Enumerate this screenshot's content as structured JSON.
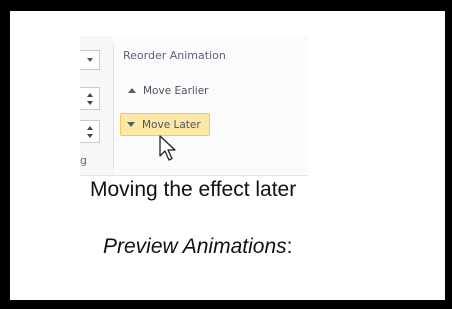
{
  "ribbon": {
    "partial_group_label": "g",
    "group_title": "Reorder Animation",
    "commands": {
      "move_earlier": "Move Earlier",
      "move_later": "Move Later"
    },
    "hover_color": "#fde9a5"
  },
  "captions": {
    "main": "Moving the effect later",
    "preview_italic": "Preview Animations",
    "preview_suffix": ":"
  },
  "icons": {
    "move_earlier": "triangle-up-icon",
    "move_later": "triangle-down-icon",
    "pointer": "mouse-pointer-icon"
  }
}
